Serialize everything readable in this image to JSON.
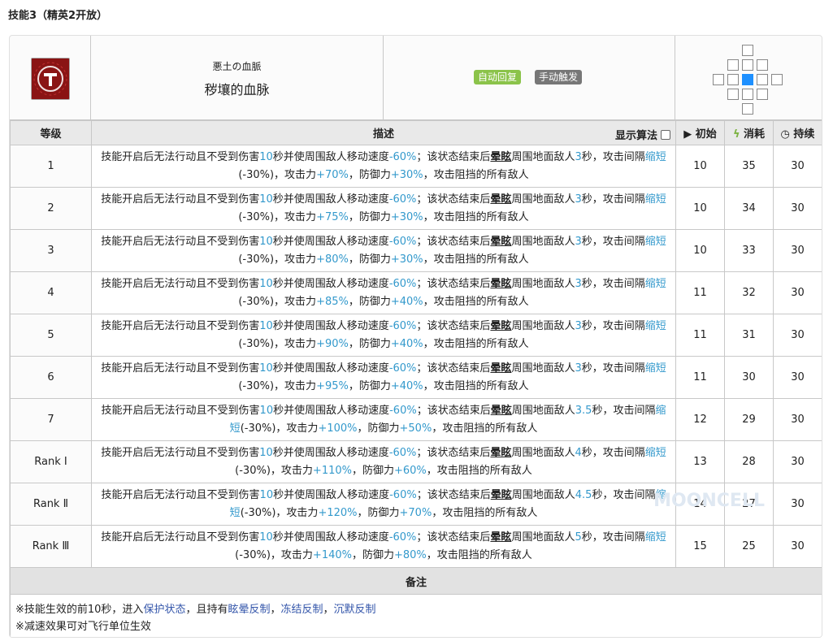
{
  "page_title": "技能3（精英2开放）",
  "skill": {
    "name_jp": "悪土の血脈",
    "name": "秽壤的血脉",
    "tags": [
      {
        "label": "自动回复",
        "color": "#8bc34a"
      },
      {
        "label": "手动触发",
        "color": "#777777"
      }
    ],
    "icon_name": "skill-icon"
  },
  "headers": {
    "level": "等级",
    "desc": "描述",
    "algo": "显示算法",
    "initial": "初始",
    "cost": "消耗",
    "duration": "持续"
  },
  "rows": [
    {
      "level": "1",
      "p1": "技能开启后无法行动且不受到伤害",
      "t1": "10",
      "p2": "秒并使周围敌人移动速度",
      "spd": "-60%",
      "p3": "；该状态结束后",
      "stun": "晕眩",
      "p4": "周围地面敌人",
      "sec": "3",
      "p5": "秒，攻击间隔",
      "short": "缩短",
      "p6": "(-30%)",
      "p7": "，攻击力",
      "atk": "+70%",
      "p8": "，防御力",
      "def": "+30%",
      "p9": "，攻击阻挡的所有敌人",
      "init": "10",
      "cost": "35",
      "dur": "30"
    },
    {
      "level": "2",
      "p1": "技能开启后无法行动且不受到伤害",
      "t1": "10",
      "p2": "秒并使周围敌人移动速度",
      "spd": "-60%",
      "p3": "；该状态结束后",
      "stun": "晕眩",
      "p4": "周围地面敌人",
      "sec": "3",
      "p5": "秒，攻击间隔",
      "short": "缩短",
      "p6": "(-30%)",
      "p7": "，攻击力",
      "atk": "+75%",
      "p8": "，防御力",
      "def": "+30%",
      "p9": "，攻击阻挡的所有敌人",
      "init": "10",
      "cost": "34",
      "dur": "30"
    },
    {
      "level": "3",
      "p1": "技能开启后无法行动且不受到伤害",
      "t1": "10",
      "p2": "秒并使周围敌人移动速度",
      "spd": "-60%",
      "p3": "；该状态结束后",
      "stun": "晕眩",
      "p4": "周围地面敌人",
      "sec": "3",
      "p5": "秒，攻击间隔",
      "short": "缩短",
      "p6": "(-30%)",
      "p7": "，攻击力",
      "atk": "+80%",
      "p8": "，防御力",
      "def": "+30%",
      "p9": "，攻击阻挡的所有敌人",
      "init": "10",
      "cost": "33",
      "dur": "30"
    },
    {
      "level": "4",
      "p1": "技能开启后无法行动且不受到伤害",
      "t1": "10",
      "p2": "秒并使周围敌人移动速度",
      "spd": "-60%",
      "p3": "；该状态结束后",
      "stun": "晕眩",
      "p4": "周围地面敌人",
      "sec": "3",
      "p5": "秒，攻击间隔",
      "short": "缩短",
      "p6": "(-30%)",
      "p7": "，攻击力",
      "atk": "+85%",
      "p8": "，防御力",
      "def": "+40%",
      "p9": "，攻击阻挡的所有敌人",
      "init": "11",
      "cost": "32",
      "dur": "30"
    },
    {
      "level": "5",
      "p1": "技能开启后无法行动且不受到伤害",
      "t1": "10",
      "p2": "秒并使周围敌人移动速度",
      "spd": "-60%",
      "p3": "；该状态结束后",
      "stun": "晕眩",
      "p4": "周围地面敌人",
      "sec": "3",
      "p5": "秒，攻击间隔",
      "short": "缩短",
      "p6": "(-30%)",
      "p7": "，攻击力",
      "atk": "+90%",
      "p8": "，防御力",
      "def": "+40%",
      "p9": "，攻击阻挡的所有敌人",
      "init": "11",
      "cost": "31",
      "dur": "30"
    },
    {
      "level": "6",
      "p1": "技能开启后无法行动且不受到伤害",
      "t1": "10",
      "p2": "秒并使周围敌人移动速度",
      "spd": "-60%",
      "p3": "；该状态结束后",
      "stun": "晕眩",
      "p4": "周围地面敌人",
      "sec": "3",
      "p5": "秒，攻击间隔",
      "short": "缩短",
      "p6": "(-30%)",
      "p7": "，攻击力",
      "atk": "+95%",
      "p8": "，防御力",
      "def": "+40%",
      "p9": "，攻击阻挡的所有敌人",
      "init": "11",
      "cost": "30",
      "dur": "30"
    },
    {
      "level": "7",
      "p1": "技能开启后无法行动且不受到伤害",
      "t1": "10",
      "p2": "秒并使周围敌人移动速度",
      "spd": "-60%",
      "p3": "；该状态结束后",
      "stun": "晕眩",
      "p4": "周围地面敌人",
      "sec": "3.5",
      "p5": "秒，攻击间隔",
      "short": "缩短",
      "p6": "(-30%)",
      "p7": "，攻击力",
      "atk": "+100%",
      "p8": "，防御力",
      "def": "+50%",
      "p9": "，攻击阻挡的所有敌人",
      "init": "12",
      "cost": "29",
      "dur": "30"
    },
    {
      "level": "Rank Ⅰ",
      "p1": "技能开启后无法行动且不受到伤害",
      "t1": "10",
      "p2": "秒并使周围敌人移动速度",
      "spd": "-60%",
      "p3": "；该状态结束后",
      "stun": "晕眩",
      "p4": "周围地面敌人",
      "sec": "4",
      "p5": "秒，攻击间隔",
      "short": "缩短",
      "p6": "(-30%)",
      "p7": "，攻击力",
      "atk": "+110%",
      "p8": "，防御力",
      "def": "+60%",
      "p9": "，攻击阻挡的所有敌人",
      "init": "13",
      "cost": "28",
      "dur": "30"
    },
    {
      "level": "Rank Ⅱ",
      "p1": "技能开启后无法行动且不受到伤害",
      "t1": "10",
      "p2": "秒并使周围敌人移动速度",
      "spd": "-60%",
      "p3": "；该状态结束后",
      "stun": "晕眩",
      "p4": "周围地面敌人",
      "sec": "4.5",
      "p5": "秒，攻击间隔",
      "short": "缩短",
      "p6": "(-30%)",
      "p7": "，攻击力",
      "atk": "+120%",
      "p8": "，防御力",
      "def": "+70%",
      "p9": "，攻击阻挡的所有敌人",
      "init": "14",
      "cost": "27",
      "dur": "30"
    },
    {
      "level": "Rank Ⅲ",
      "p1": "技能开启后无法行动且不受到伤害",
      "t1": "10",
      "p2": "秒并使周围敌人移动速度",
      "spd": "-60%",
      "p3": "；该状态结束后",
      "stun": "晕眩",
      "p4": "周围地面敌人",
      "sec": "5",
      "p5": "秒，攻击间隔",
      "short": "缩短",
      "p6": "(-30%)",
      "p7": "，攻击力",
      "atk": "+140%",
      "p8": "，防御力",
      "def": "+80%",
      "p9": "，攻击阻挡的所有敌人",
      "init": "15",
      "cost": "25",
      "dur": "30"
    }
  ],
  "notes": {
    "header": "备注",
    "line1_prefix": "※技能生效的前10秒，进入",
    "line1_link1": "保护状态",
    "line1_mid": "，且持有",
    "line1_link2": "眩晕反制",
    "line1_sep": "，",
    "line1_link3": "冻结反制",
    "line1_sep2": "，",
    "line1_link4": "沉默反制",
    "line2": "※减速效果可对飞行单位生效"
  },
  "watermark": "MOONCELL",
  "colors": {
    "highlight": "#3399cc",
    "range_self": "#1e90ff"
  }
}
